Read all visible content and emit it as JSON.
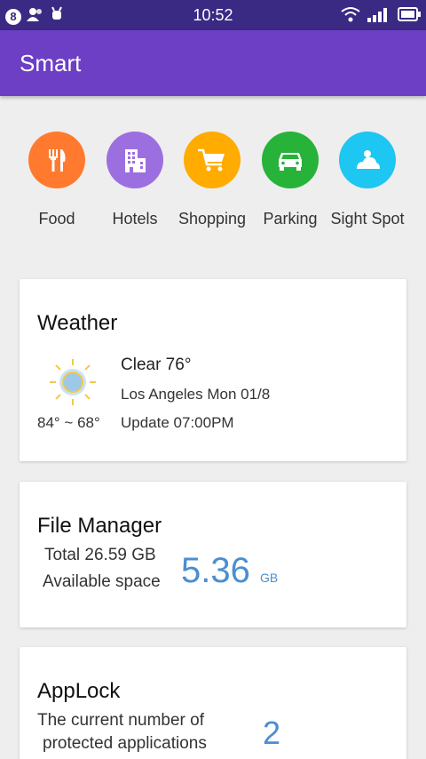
{
  "status_bar": {
    "notification_count": "8",
    "time": "10:52"
  },
  "app_bar": {
    "title": "Smart"
  },
  "categories": [
    {
      "label": "Food",
      "color": "#ff7a2f",
      "icon": "fork-knife-icon"
    },
    {
      "label": "Hotels",
      "color": "#9c6fe0",
      "icon": "building-icon"
    },
    {
      "label": "Shopping",
      "color": "#ffab00",
      "icon": "cart-icon"
    },
    {
      "label": "Parking",
      "color": "#27b23a",
      "icon": "car-icon"
    },
    {
      "label": "Sight Spot",
      "color": "#1ec6f2",
      "icon": "cloud-sun-icon"
    }
  ],
  "weather": {
    "title": "Weather",
    "condition": "Clear 76°",
    "location_date": "Los Angeles Mon 01/8",
    "range": "84° ~ 68°",
    "update": "Update  07:00PM"
  },
  "file_manager": {
    "title": "File Manager",
    "total": "Total 26.59 GB",
    "available_label": "Available space",
    "available_value": "5.36",
    "available_unit": "GB"
  },
  "applock": {
    "title": "AppLock",
    "line1": "The current number of",
    "line2": "protected applications",
    "count": "2"
  },
  "colors": {
    "status_bar": "#3a2a84",
    "app_bar": "#6c3fc4",
    "accent_number": "#4a8fd0"
  }
}
